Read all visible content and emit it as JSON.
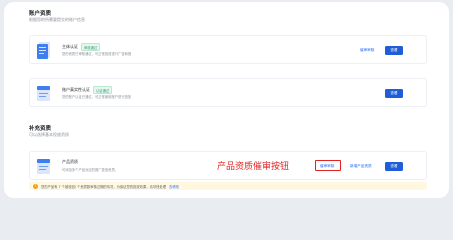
{
  "account_section": {
    "title": "账户资质",
    "subtitle": "根据您的所需要提交的账户信息"
  },
  "cards": [
    {
      "title": "主体认证",
      "badge": "审核通过",
      "desc": "您的资质已审核通过，可正常投放进行广告和授"
    },
    {
      "title": "账户真实性认证",
      "badge": "认证通过",
      "desc": "您的账户认证已通过，可正常使用账户进行投放"
    }
  ],
  "card1_actions": {
    "link": "催审审核",
    "button": "查看"
  },
  "card2_actions": {
    "button": "查看"
  },
  "extra_section": {
    "title": "补充资质",
    "subtitle": "可以选择基本投放资质"
  },
  "product_card": {
    "title": "产品资质",
    "desc": "可添加多个产品对应的推广投放资质。",
    "urge_link": "催审审核",
    "add_link": "新增产品资质",
    "button": "查看"
  },
  "annotation": "产品资质催审按钮",
  "notice": {
    "icon": "!",
    "text": "您的产品有 7 个被驳回/ 个资质数审核过期的情况，为保证您的投放效果，请尽快处理",
    "link": "去修改"
  },
  "colors": {
    "primary": "#1f5ed8",
    "link": "#2469f6",
    "success": "#2ba471",
    "annotation_red": "#e02424",
    "notice_bg": "#fff7e0"
  }
}
